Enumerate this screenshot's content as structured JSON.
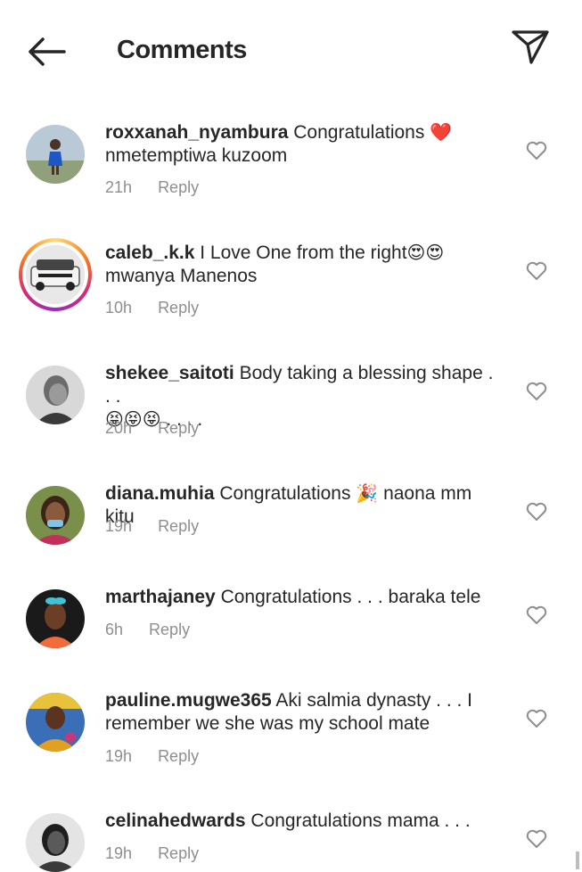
{
  "header": {
    "title": "Comments"
  },
  "reply_label": "Reply",
  "colors": {
    "text": "#262626",
    "muted": "#8e8e8e",
    "heart": "#e0245e"
  },
  "comments": [
    {
      "username": "roxxanah_nyambura",
      "text": "Congratulations",
      "emoji": "❤️",
      "line2": "nmetemptiwa kuzoom",
      "time": "21h"
    },
    {
      "username": "caleb_.k.k",
      "text": "I Love One from the right",
      "emoji": "😍😍",
      "line2": "mwanya Manenos",
      "time": "10h"
    },
    {
      "username": "shekee_saitoti",
      "text": "Body taking a blessing shape . . .",
      "emoji": "😝😝😝",
      "line2": ". . . .",
      "time": "20h"
    },
    {
      "username": "diana.muhia",
      "text": "Congratulations",
      "emoji": "🎉",
      "text_after": "naona mm kitu",
      "time": "19h"
    },
    {
      "username": "marthajaney",
      "text": "Congratulations . . . baraka tele",
      "time": "6h"
    },
    {
      "username": "pauline.mugwe365",
      "text": "Aki salmia dynasty . . . I",
      "line2": "remember we she was my school mate",
      "time": "19h"
    },
    {
      "username": "celinahedwards",
      "text": "Congratulations mama . . .",
      "time": "19h"
    }
  ]
}
